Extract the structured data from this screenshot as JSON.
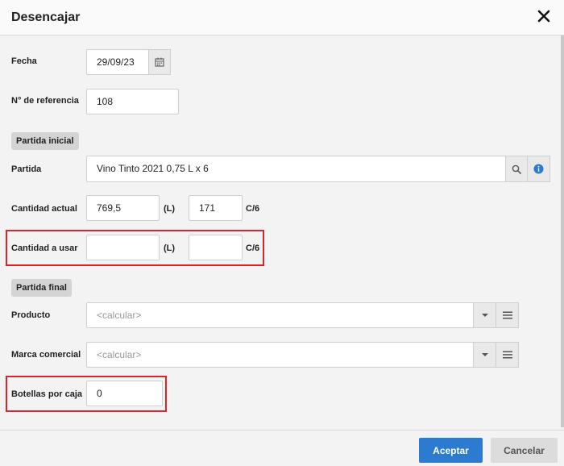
{
  "dialog": {
    "title": "Desencajar",
    "close_label": "✕"
  },
  "form": {
    "fecha": {
      "label": "Fecha",
      "value": "29/09/23"
    },
    "referencia": {
      "label": "N° de referencia",
      "value": "108"
    },
    "partida_inicial": {
      "section_label": "Partida inicial"
    },
    "partida": {
      "label": "Partida",
      "value": "Vino Tinto 2021 0,75 L x 6"
    },
    "cantidad_actual": {
      "label": "Cantidad actual",
      "liters": "769,5",
      "liters_unit": "(L)",
      "cases": "171",
      "cases_unit": "C/6"
    },
    "cantidad_usar": {
      "label": "Cantidad a usar",
      "liters": "",
      "liters_unit": "(L)",
      "cases": "",
      "cases_unit": "C/6"
    },
    "partida_final": {
      "section_label": "Partida final"
    },
    "producto": {
      "label": "Producto",
      "placeholder": "<calcular>"
    },
    "marca": {
      "label": "Marca comercial",
      "placeholder": "<calcular>"
    },
    "botellas": {
      "label": "Botellas por caja",
      "value": "0"
    }
  },
  "footer": {
    "accept_label": "Aceptar",
    "cancel_label": "Cancelar"
  },
  "colors": {
    "primary": "#2d7bd0",
    "highlight": "#d9262b",
    "info": "#2d7bd0"
  }
}
